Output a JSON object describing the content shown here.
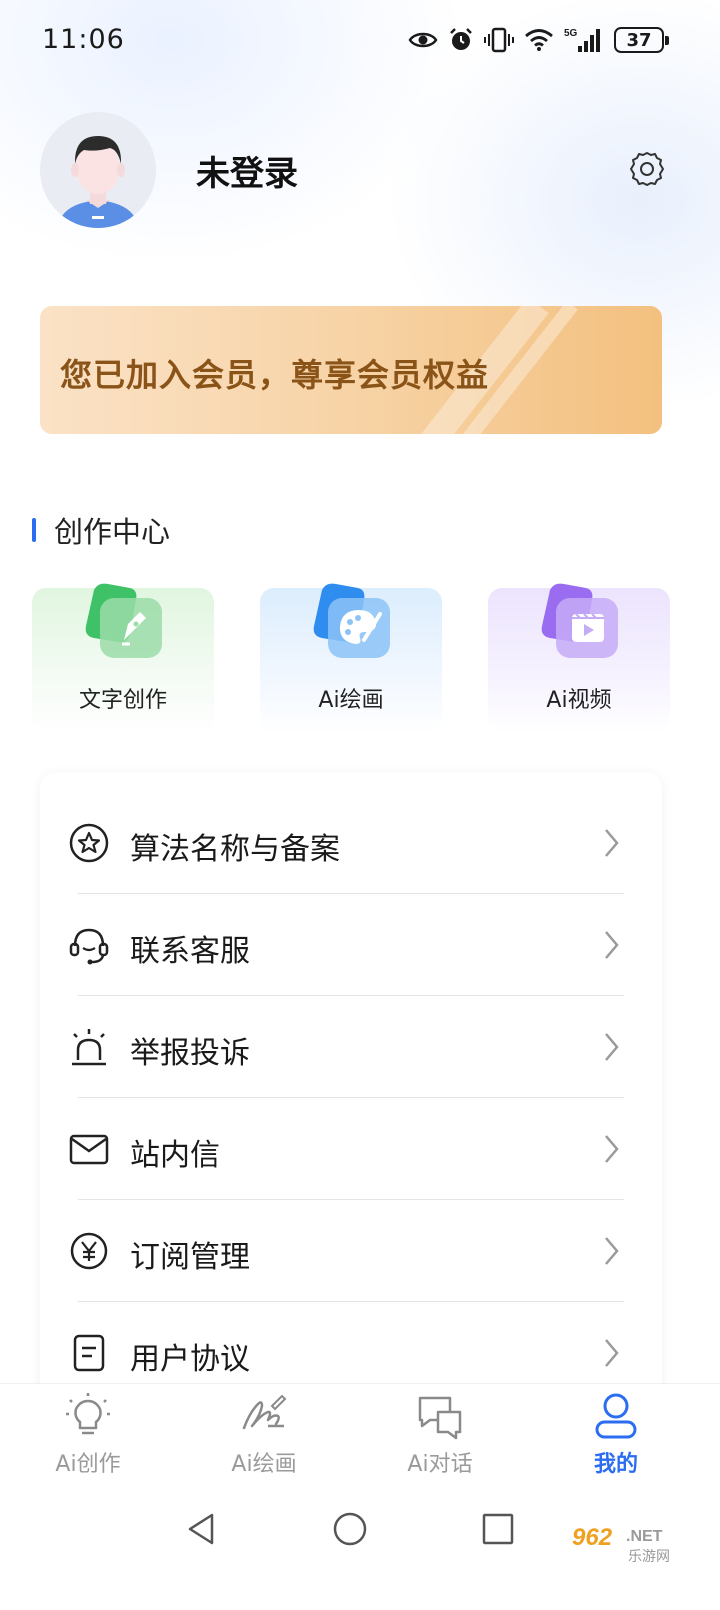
{
  "status_bar": {
    "time": "11:06",
    "battery": "37",
    "network": "5G"
  },
  "profile": {
    "username": "未登录"
  },
  "member_banner": {
    "text": "您已加入会员，尊享会员权益",
    "colors": [
      "#fbe2c6",
      "#f3c07f"
    ],
    "text_color": "#8a5318"
  },
  "creation_center": {
    "title": "创作中心",
    "cards": [
      {
        "label": "文字创作",
        "icon": "pen-nib-icon"
      },
      {
        "label": "Ai绘画",
        "icon": "palette-icon"
      },
      {
        "label": "Ai视频",
        "icon": "video-clapper-icon"
      }
    ]
  },
  "menu": {
    "items": [
      {
        "label": "算法名称与备案",
        "icon": "star-badge-icon"
      },
      {
        "label": "联系客服",
        "icon": "headset-icon"
      },
      {
        "label": "举报投诉",
        "icon": "alarm-siren-icon"
      },
      {
        "label": "站内信",
        "icon": "envelope-icon"
      },
      {
        "label": "订阅管理",
        "icon": "yuan-coin-icon"
      },
      {
        "label": "用户协议",
        "icon": "document-icon"
      }
    ]
  },
  "bottom_nav": {
    "items": [
      {
        "label": "Ai创作",
        "icon": "lightbulb-icon",
        "active": false
      },
      {
        "label": "Ai绘画",
        "icon": "signature-icon",
        "active": false
      },
      {
        "label": "Ai对话",
        "icon": "chat-bubbles-icon",
        "active": false
      },
      {
        "label": "我的",
        "icon": "user-icon",
        "active": true
      }
    ]
  },
  "theme": {
    "accent": "#2b6df0",
    "inactive": "#9a9a9a"
  },
  "watermark": "962.NET 乐游网"
}
